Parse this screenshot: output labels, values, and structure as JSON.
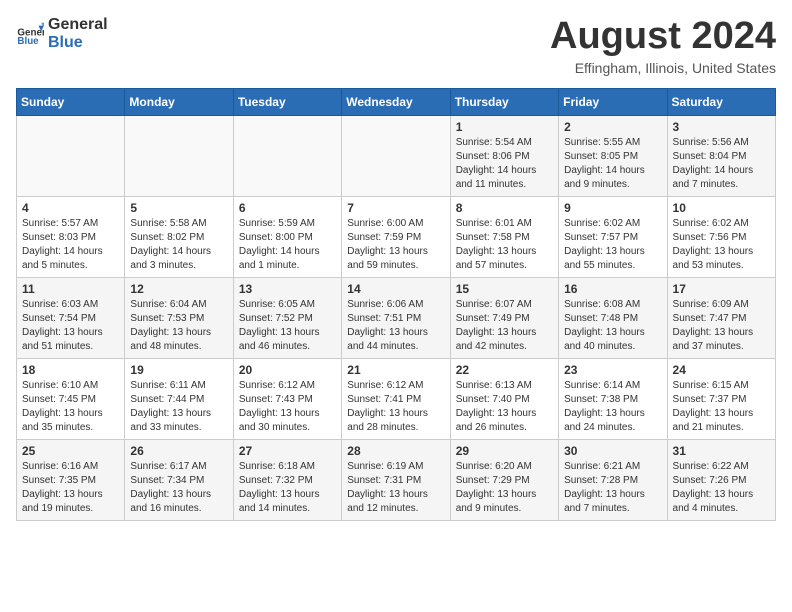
{
  "header": {
    "logo_general": "General",
    "logo_blue": "Blue",
    "title": "August 2024",
    "location": "Effingham, Illinois, United States"
  },
  "weekdays": [
    "Sunday",
    "Monday",
    "Tuesday",
    "Wednesday",
    "Thursday",
    "Friday",
    "Saturday"
  ],
  "weeks": [
    [
      {
        "day": "",
        "info": ""
      },
      {
        "day": "",
        "info": ""
      },
      {
        "day": "",
        "info": ""
      },
      {
        "day": "",
        "info": ""
      },
      {
        "day": "1",
        "info": "Sunrise: 5:54 AM\nSunset: 8:06 PM\nDaylight: 14 hours\nand 11 minutes."
      },
      {
        "day": "2",
        "info": "Sunrise: 5:55 AM\nSunset: 8:05 PM\nDaylight: 14 hours\nand 9 minutes."
      },
      {
        "day": "3",
        "info": "Sunrise: 5:56 AM\nSunset: 8:04 PM\nDaylight: 14 hours\nand 7 minutes."
      }
    ],
    [
      {
        "day": "4",
        "info": "Sunrise: 5:57 AM\nSunset: 8:03 PM\nDaylight: 14 hours\nand 5 minutes."
      },
      {
        "day": "5",
        "info": "Sunrise: 5:58 AM\nSunset: 8:02 PM\nDaylight: 14 hours\nand 3 minutes."
      },
      {
        "day": "6",
        "info": "Sunrise: 5:59 AM\nSunset: 8:00 PM\nDaylight: 14 hours\nand 1 minute."
      },
      {
        "day": "7",
        "info": "Sunrise: 6:00 AM\nSunset: 7:59 PM\nDaylight: 13 hours\nand 59 minutes."
      },
      {
        "day": "8",
        "info": "Sunrise: 6:01 AM\nSunset: 7:58 PM\nDaylight: 13 hours\nand 57 minutes."
      },
      {
        "day": "9",
        "info": "Sunrise: 6:02 AM\nSunset: 7:57 PM\nDaylight: 13 hours\nand 55 minutes."
      },
      {
        "day": "10",
        "info": "Sunrise: 6:02 AM\nSunset: 7:56 PM\nDaylight: 13 hours\nand 53 minutes."
      }
    ],
    [
      {
        "day": "11",
        "info": "Sunrise: 6:03 AM\nSunset: 7:54 PM\nDaylight: 13 hours\nand 51 minutes."
      },
      {
        "day": "12",
        "info": "Sunrise: 6:04 AM\nSunset: 7:53 PM\nDaylight: 13 hours\nand 48 minutes."
      },
      {
        "day": "13",
        "info": "Sunrise: 6:05 AM\nSunset: 7:52 PM\nDaylight: 13 hours\nand 46 minutes."
      },
      {
        "day": "14",
        "info": "Sunrise: 6:06 AM\nSunset: 7:51 PM\nDaylight: 13 hours\nand 44 minutes."
      },
      {
        "day": "15",
        "info": "Sunrise: 6:07 AM\nSunset: 7:49 PM\nDaylight: 13 hours\nand 42 minutes."
      },
      {
        "day": "16",
        "info": "Sunrise: 6:08 AM\nSunset: 7:48 PM\nDaylight: 13 hours\nand 40 minutes."
      },
      {
        "day": "17",
        "info": "Sunrise: 6:09 AM\nSunset: 7:47 PM\nDaylight: 13 hours\nand 37 minutes."
      }
    ],
    [
      {
        "day": "18",
        "info": "Sunrise: 6:10 AM\nSunset: 7:45 PM\nDaylight: 13 hours\nand 35 minutes."
      },
      {
        "day": "19",
        "info": "Sunrise: 6:11 AM\nSunset: 7:44 PM\nDaylight: 13 hours\nand 33 minutes."
      },
      {
        "day": "20",
        "info": "Sunrise: 6:12 AM\nSunset: 7:43 PM\nDaylight: 13 hours\nand 30 minutes."
      },
      {
        "day": "21",
        "info": "Sunrise: 6:12 AM\nSunset: 7:41 PM\nDaylight: 13 hours\nand 28 minutes."
      },
      {
        "day": "22",
        "info": "Sunrise: 6:13 AM\nSunset: 7:40 PM\nDaylight: 13 hours\nand 26 minutes."
      },
      {
        "day": "23",
        "info": "Sunrise: 6:14 AM\nSunset: 7:38 PM\nDaylight: 13 hours\nand 24 minutes."
      },
      {
        "day": "24",
        "info": "Sunrise: 6:15 AM\nSunset: 7:37 PM\nDaylight: 13 hours\nand 21 minutes."
      }
    ],
    [
      {
        "day": "25",
        "info": "Sunrise: 6:16 AM\nSunset: 7:35 PM\nDaylight: 13 hours\nand 19 minutes."
      },
      {
        "day": "26",
        "info": "Sunrise: 6:17 AM\nSunset: 7:34 PM\nDaylight: 13 hours\nand 16 minutes."
      },
      {
        "day": "27",
        "info": "Sunrise: 6:18 AM\nSunset: 7:32 PM\nDaylight: 13 hours\nand 14 minutes."
      },
      {
        "day": "28",
        "info": "Sunrise: 6:19 AM\nSunset: 7:31 PM\nDaylight: 13 hours\nand 12 minutes."
      },
      {
        "day": "29",
        "info": "Sunrise: 6:20 AM\nSunset: 7:29 PM\nDaylight: 13 hours\nand 9 minutes."
      },
      {
        "day": "30",
        "info": "Sunrise: 6:21 AM\nSunset: 7:28 PM\nDaylight: 13 hours\nand 7 minutes."
      },
      {
        "day": "31",
        "info": "Sunrise: 6:22 AM\nSunset: 7:26 PM\nDaylight: 13 hours\nand 4 minutes."
      }
    ]
  ]
}
